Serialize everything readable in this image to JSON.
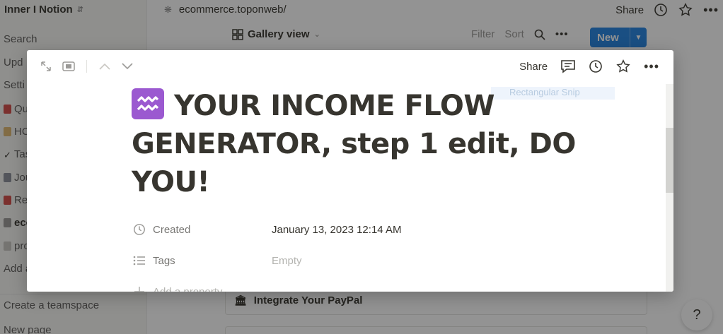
{
  "workspace": {
    "name": "Inner I Notion"
  },
  "sidebar": {
    "items": [
      {
        "label": "Search",
        "icon": "",
        "top": 0
      },
      {
        "label": "Upd",
        "icon": ""
      },
      {
        "label": "Setti",
        "icon": ""
      },
      {
        "label": "Qu",
        "icon": "pushpin-icon"
      },
      {
        "label": "HC",
        "icon": "house-icon"
      },
      {
        "label": "Tas",
        "icon": "checkmark-icon"
      },
      {
        "label": "Jou",
        "icon": "notebook-icon"
      },
      {
        "label": "Rea",
        "icon": "book-icon"
      },
      {
        "label": "eco",
        "icon": "link-icon"
      },
      {
        "label": "pro",
        "icon": "document-icon"
      },
      {
        "label": "Add a",
        "icon": ""
      }
    ],
    "create_teamspace": "Create a teamspace",
    "new_page": "New page"
  },
  "breadcrumb": {
    "page": "ecommerce.toponweb/"
  },
  "topbar": {
    "share": "Share"
  },
  "view": {
    "name": "Gallery view",
    "filter": "Filter",
    "sort": "Sort",
    "new_label": "New"
  },
  "gallery_cards": [
    {
      "title": "Integrate Your PayPal"
    }
  ],
  "help": {
    "label": "?"
  },
  "modal": {
    "share": "Share",
    "title": "YOUR INCOME FLOW GENERATOR, step 1 edit, DO YOU!",
    "emoji": "aquarius-icon",
    "ghost_tag": "Rectangular Snip",
    "properties": [
      {
        "name": "Created",
        "value": "January 13, 2023 12:14 AM",
        "icon": "clock-icon"
      },
      {
        "name": "Tags",
        "value": "Empty",
        "icon": "list-icon"
      }
    ],
    "add_property": "Add a property"
  },
  "colors": {
    "accent": "#2383e2",
    "emoji_bg": "#9b59d0",
    "text": "#37352f",
    "muted": "#9b9a97"
  }
}
